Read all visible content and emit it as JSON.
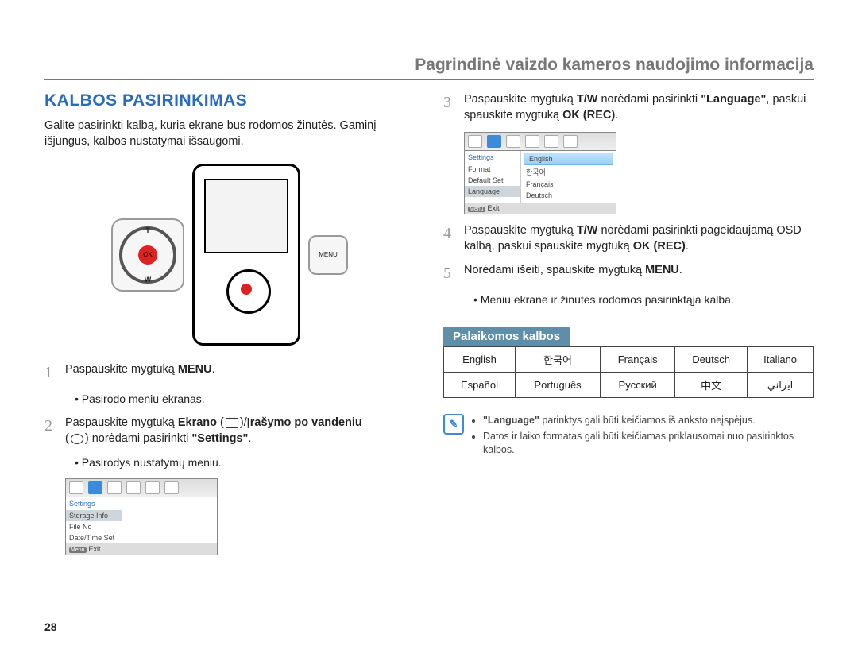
{
  "header": "Pagrindinė vaizdo kameros naudojimo informacija",
  "section_title": "KALBOS PASIRINKIMAS",
  "intro": "Galite pasirinkti kalbą, kuria ekrane bus rodomos žinutės. Gaminį išjungus, kalbos nustatymai išsaugomi.",
  "pad": {
    "t": "T",
    "w": "W",
    "ok": "OK"
  },
  "menu_btn": "MENU",
  "steps_left": {
    "s1": {
      "num": "1",
      "text_a": "Paspauskite mygtuką ",
      "text_b": "MENU",
      "text_c": ".",
      "bullet": "Pasirodo meniu ekranas."
    },
    "s2": {
      "num": "2",
      "text_a": "Paspauskite mygtuką ",
      "text_b": "Ekrano",
      "text_c": " (",
      "text_d": ")/",
      "text_e": "Įrašymo po vandeniu",
      "text_f": " (",
      "text_g": ") norėdami pasirinkti ",
      "text_h": "\"Settings\"",
      "text_i": ".",
      "bullet": "Pasirodys nustatymų meniu."
    }
  },
  "menubox1": {
    "hdr": "Settings",
    "rows": [
      "Storage Info",
      "File No",
      "Date/Time Set"
    ],
    "sel_index": 0,
    "foot_btn": "Menu",
    "foot": "Exit"
  },
  "steps_right": {
    "s3": {
      "num": "3",
      "text_a": "Paspauskite mygtuką ",
      "text_b": "T/W",
      "text_c": " norėdami pasirinkti ",
      "text_d": "\"Language\"",
      "text_e": ", paskui spauskite mygtuką ",
      "text_f": "OK (REC)",
      "text_g": "."
    },
    "s4": {
      "num": "4",
      "text_a": "Paspauskite mygtuką ",
      "text_b": "T/W",
      "text_c": " norėdami pasirinkti pageidaujamą OSD kalbą, paskui spauskite mygtuką ",
      "text_d": "OK (REC)",
      "text_e": "."
    },
    "s5": {
      "num": "5",
      "text_a": "Norėdami išeiti, spauskite mygtuką ",
      "text_b": "MENU",
      "text_c": ".",
      "bullet": "Meniu ekrane ir žinutės rodomos pasirinktąja kalba."
    }
  },
  "menubox2": {
    "hdr": "Settings",
    "rows": [
      "Format",
      "Default Set",
      "Language"
    ],
    "sel_index": 2,
    "opts": [
      "English",
      "한국어",
      "Français",
      "Deutsch"
    ],
    "opt_sel_index": 0,
    "foot_btn": "Menu",
    "foot": "Exit"
  },
  "supported": {
    "title": "Palaikomos kalbos",
    "cells": [
      "English",
      "한국어",
      "Français",
      "Deutsch",
      "Italiano",
      "Español",
      "Português",
      "Русский",
      "中文",
      "ايراني"
    ]
  },
  "note": {
    "n1_a": "\"Language\"",
    "n1_b": " parinktys gali būti keičiamos iš anksto neįspėjus.",
    "n2": "Datos ir laiko formatas gali būti keičiamas priklausomai nuo pasirinktos kalbos."
  },
  "pagenum": "28"
}
